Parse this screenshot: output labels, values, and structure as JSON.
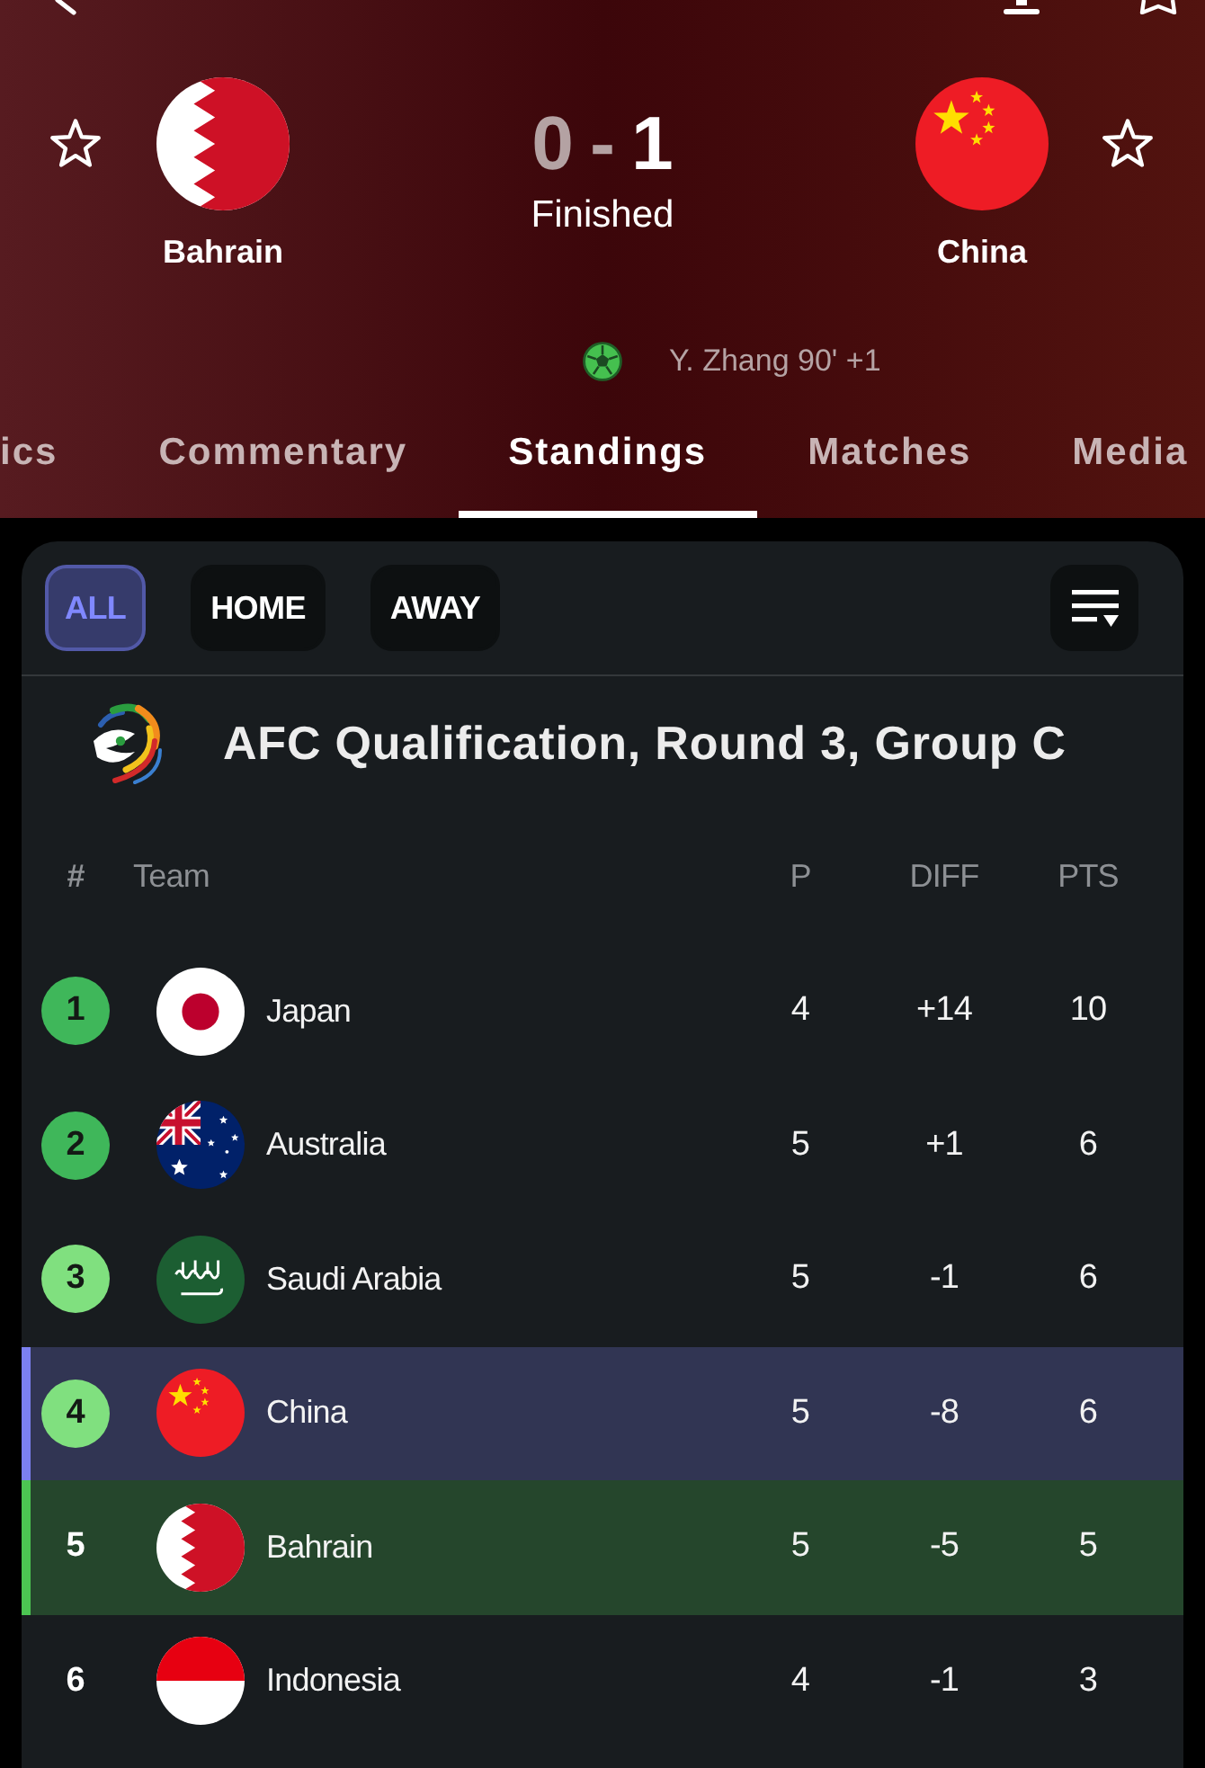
{
  "match": {
    "home": {
      "name": "Bahrain",
      "kind": "bahrain",
      "starred": false,
      "score": "0",
      "winner": false
    },
    "away": {
      "name": "China",
      "kind": "china",
      "starred": false,
      "score": "1",
      "winner": true
    },
    "separator": "-",
    "status": "Finished",
    "goals": [
      {
        "text": "Y. Zhang 90' +1"
      }
    ]
  },
  "tabs": [
    {
      "label": "ics",
      "selected": false
    },
    {
      "label": "Commentary",
      "selected": false
    },
    {
      "label": "Standings",
      "selected": true
    },
    {
      "label": "Matches",
      "selected": false
    },
    {
      "label": "Media",
      "selected": false
    }
  ],
  "filters": [
    {
      "label": "ALL",
      "selected": true
    },
    {
      "label": "HOME",
      "selected": false
    },
    {
      "label": "AWAY",
      "selected": false
    }
  ],
  "league": {
    "name": "AFC Qualification, Round 3, Group C"
  },
  "table": {
    "columns": [
      "#",
      "Team",
      "P",
      "DIFF",
      "PTS"
    ],
    "rows": [
      {
        "rank": "1",
        "team": "Japan",
        "kind": "japan",
        "played": "4",
        "diff": "+14",
        "points": "10",
        "badge": {
          "color": "#3fb75a"
        }
      },
      {
        "rank": "2",
        "team": "Australia",
        "kind": "australia",
        "played": "5",
        "diff": "+1",
        "points": "6",
        "badge": {
          "color": "#3fb75a"
        }
      },
      {
        "rank": "3",
        "team": "Saudi Arabia",
        "kind": "saudi",
        "played": "5",
        "diff": "-1",
        "points": "6",
        "badge": {
          "color": "#80e07f"
        }
      },
      {
        "rank": "4",
        "team": "China",
        "kind": "china",
        "played": "5",
        "diff": "-8",
        "points": "6",
        "badge": {
          "color": "#80e07f"
        },
        "highlight": {
          "color": "#7b80f0"
        }
      },
      {
        "rank": "5",
        "team": "Bahrain",
        "kind": "bahrain",
        "played": "5",
        "diff": "-5",
        "points": "5",
        "highlight": {
          "color": "#4cc552"
        }
      },
      {
        "rank": "6",
        "team": "Indonesia",
        "kind": "indonesia",
        "played": "4",
        "diff": "-1",
        "points": "3"
      }
    ]
  }
}
